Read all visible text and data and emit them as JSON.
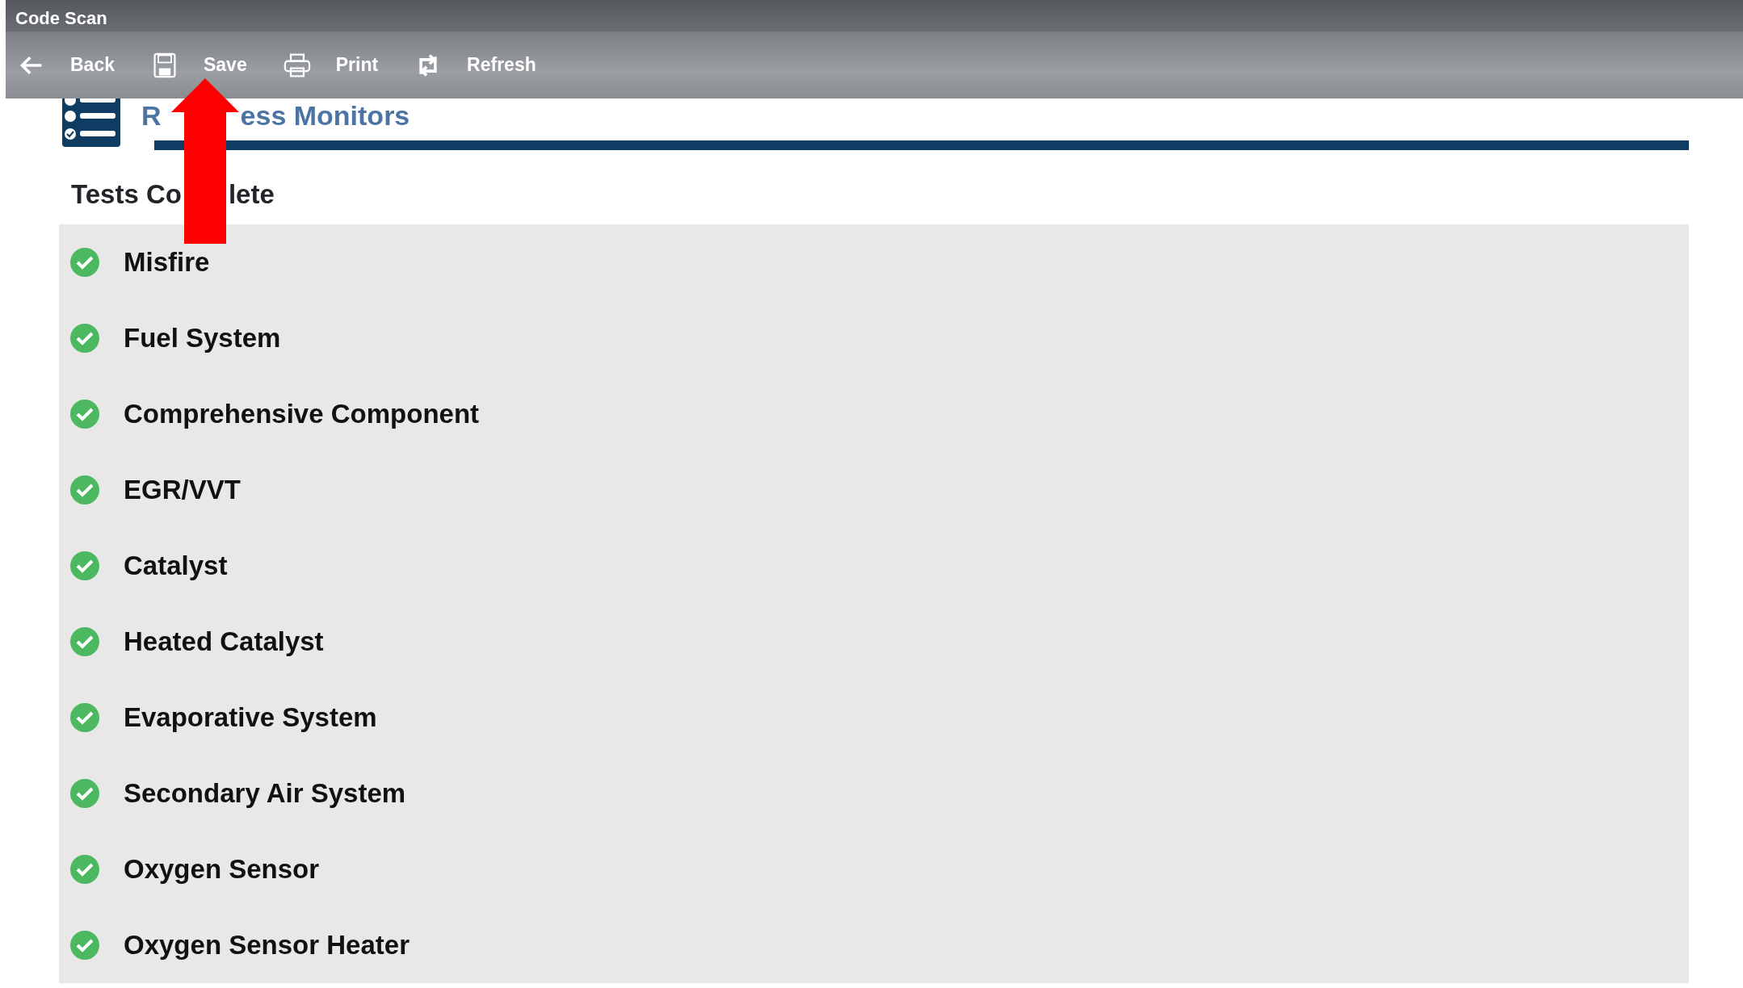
{
  "window": {
    "title": "Code Scan"
  },
  "toolbar": [
    {
      "label": "Back"
    },
    {
      "label": "Save"
    },
    {
      "label": "Print"
    },
    {
      "label": "Refresh"
    }
  ],
  "section": {
    "title_parts": [
      "R",
      "ess Monitors"
    ],
    "subtitle_parts": [
      "Tests Co",
      "lete"
    ]
  },
  "monitors": [
    {
      "name": "Misfire",
      "complete": true
    },
    {
      "name": "Fuel System",
      "complete": true
    },
    {
      "name": "Comprehensive Component",
      "complete": true
    },
    {
      "name": "EGR/VVT",
      "complete": true
    },
    {
      "name": "Catalyst",
      "complete": true
    },
    {
      "name": "Heated Catalyst",
      "complete": true
    },
    {
      "name": "Evaporative System",
      "complete": true
    },
    {
      "name": "Secondary Air System",
      "complete": true
    },
    {
      "name": "Oxygen Sensor",
      "complete": true
    },
    {
      "name": "Oxygen Sensor Heater",
      "complete": true
    }
  ]
}
